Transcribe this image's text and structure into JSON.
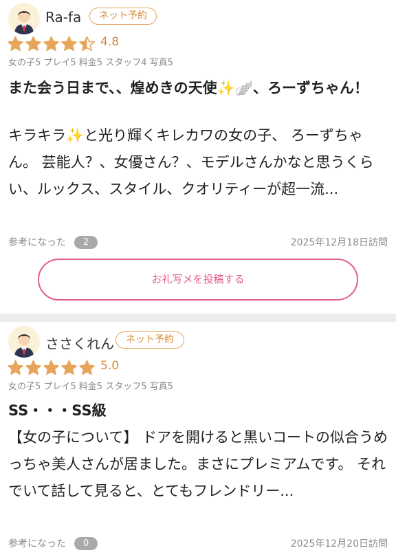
{
  "reviews": [
    {
      "username": "Ra-fa",
      "badge": "ネット予約",
      "rating": "4.8",
      "stars": 4.5,
      "subscores": "女の子5 プレイ5 料金5 スタッフ4 写真5",
      "title": "また会う日まで、、煌めきの天使✨🪽、ろーずちゃん！",
      "body": "キラキラ✨と光り輝くキレカワの女の子、 ろーずちゃん。 芸能人？、女優さん？、モデルさんかなと思うくらい、ルックス、スタイル、クオリティーが超一流...",
      "helpful_label": "参考になった",
      "helpful_count": "2",
      "visit_date": "2025年12月18日訪問"
    },
    {
      "username": "ささくれん",
      "badge": "ネット予約",
      "rating": "5.0",
      "stars": 5,
      "subscores": "女の子5 プレイ5 料金5 スタッフ5 写真5",
      "title": "SS・・・SS級",
      "body": "【女の子について】 ドアを開けると黒いコートの似合うめっちゃ美人さんが居ました。まさにプレミアムです。 それでいて話して見ると、とてもフレンドリー...",
      "helpful_label": "参考になった",
      "helpful_count": "0",
      "visit_date": "2025年12月20日訪問"
    }
  ],
  "post_photo_button": "お礼写メを投稿する",
  "colors": {
    "star": "#e7a55b",
    "badge": "#e6a55a",
    "button_border": "#e35b8a",
    "divider": "#ebebeb"
  },
  "icons": {
    "avatar": "male-avatar-icon",
    "star": "star-icon"
  }
}
